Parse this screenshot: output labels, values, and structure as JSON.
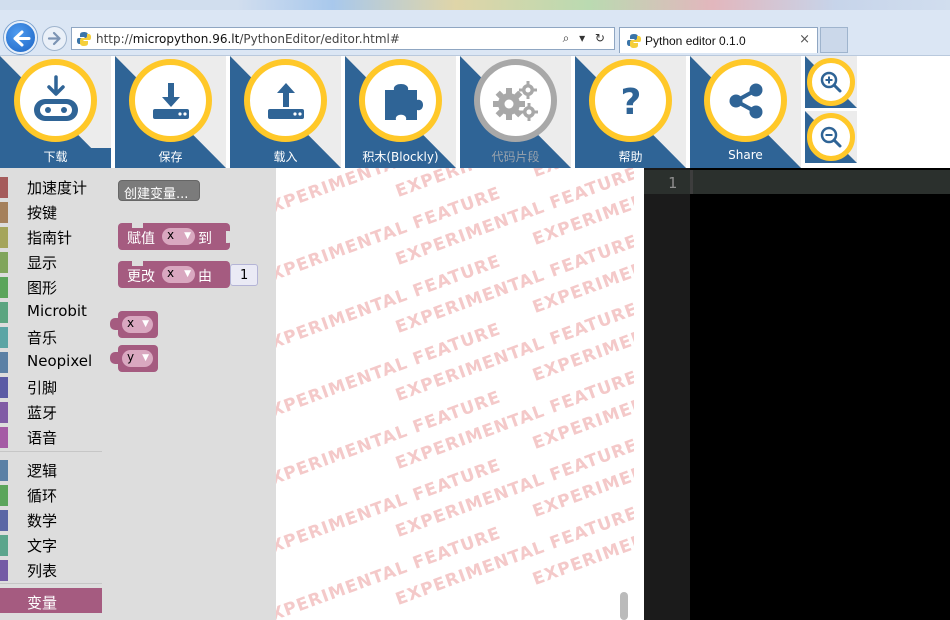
{
  "browser": {
    "url_prefix": "http://",
    "url_host": "micropython.96.lt",
    "url_path": "/PythonEditor/editor.html#",
    "addr_controls": "⌕ ▾ ↻",
    "tab_title": "Python editor 0.1.0",
    "tab_close": "×"
  },
  "toolbar": {
    "download": "下载",
    "save": "保存",
    "load": "载入",
    "blocks": "积木(Blockly)",
    "snippets": "代码片段",
    "help": "帮助",
    "share": "Share",
    "accent_color": "#ffc829",
    "tile_color": "#2f6496"
  },
  "toolbox": {
    "categories": [
      {
        "name": "加速度计",
        "color": "#a55b5b"
      },
      {
        "name": "按键",
        "color": "#a5805b"
      },
      {
        "name": "指南针",
        "color": "#a5a55b"
      },
      {
        "name": "显示",
        "color": "#80a55b"
      },
      {
        "name": "图形",
        "color": "#5ba55b"
      },
      {
        "name": "Microbit",
        "color": "#5ba580"
      },
      {
        "name": "音乐",
        "color": "#5ba5a5"
      },
      {
        "name": "Neopixel",
        "color": "#5b80a5"
      },
      {
        "name": "引脚",
        "color": "#5b5ba5"
      },
      {
        "name": "蓝牙",
        "color": "#805ba5"
      },
      {
        "name": "语音",
        "color": "#a55ba5"
      }
    ],
    "categories2": [
      {
        "name": "逻辑",
        "color": "#5b80a5"
      },
      {
        "name": "循环",
        "color": "#5ba55b"
      },
      {
        "name": "数学",
        "color": "#5b67a5"
      },
      {
        "name": "文字",
        "color": "#5ba58c"
      },
      {
        "name": "列表",
        "color": "#745ba5"
      }
    ],
    "selected": {
      "name": "变量",
      "color": "#a55b80"
    }
  },
  "flyout": {
    "create_variable": "创建变量...",
    "set_block": {
      "label": "赋值",
      "var": "x",
      "to": "到"
    },
    "change_block": {
      "label": "更改",
      "var": "x",
      "by": "由",
      "value": "1"
    },
    "var_x": "x",
    "var_y": "y"
  },
  "workspace": {
    "watermark": "EXPERIMENTAL  FEATURE"
  },
  "editor": {
    "line_numbers": [
      "1"
    ]
  }
}
